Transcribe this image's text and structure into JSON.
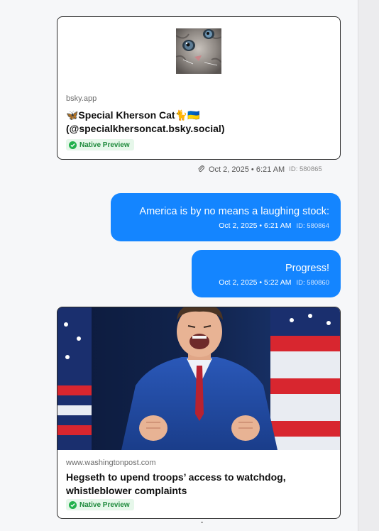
{
  "link_preview_1": {
    "source": "bsky.app",
    "title_line1": "🦋Special Kherson Cat🐈🇺🇦",
    "title_line2": "(@specialkhersoncat.bsky.social)",
    "badge": "Native Preview",
    "thumbnail_icon": "cat-photo"
  },
  "message_meta_1": {
    "time": "Oct 2, 2025 • 6:21 AM",
    "id": "ID: 580865",
    "attachment_icon": "paperclip-icon"
  },
  "bubble_1": {
    "text": "America is by no means a laughing stock:",
    "time": "Oct 2, 2025 • 6:21 AM",
    "id": "ID: 580864"
  },
  "bubble_2": {
    "text": "Progress!",
    "time": "Oct 2, 2025 • 5:22 AM",
    "id": "ID: 580860"
  },
  "link_preview_2": {
    "source": "www.washingtonpost.com",
    "title_line1": "Hegseth to upend troops’ access to watchdog,",
    "title_line2": "whistleblower complaints",
    "badge": "Native Preview",
    "image_icon": "news-photo"
  },
  "colors": {
    "bubble": "#1485ff",
    "badge_bg": "#e6f7ea",
    "badge_text": "#1e8a3c",
    "background": "#f6f7f9"
  }
}
